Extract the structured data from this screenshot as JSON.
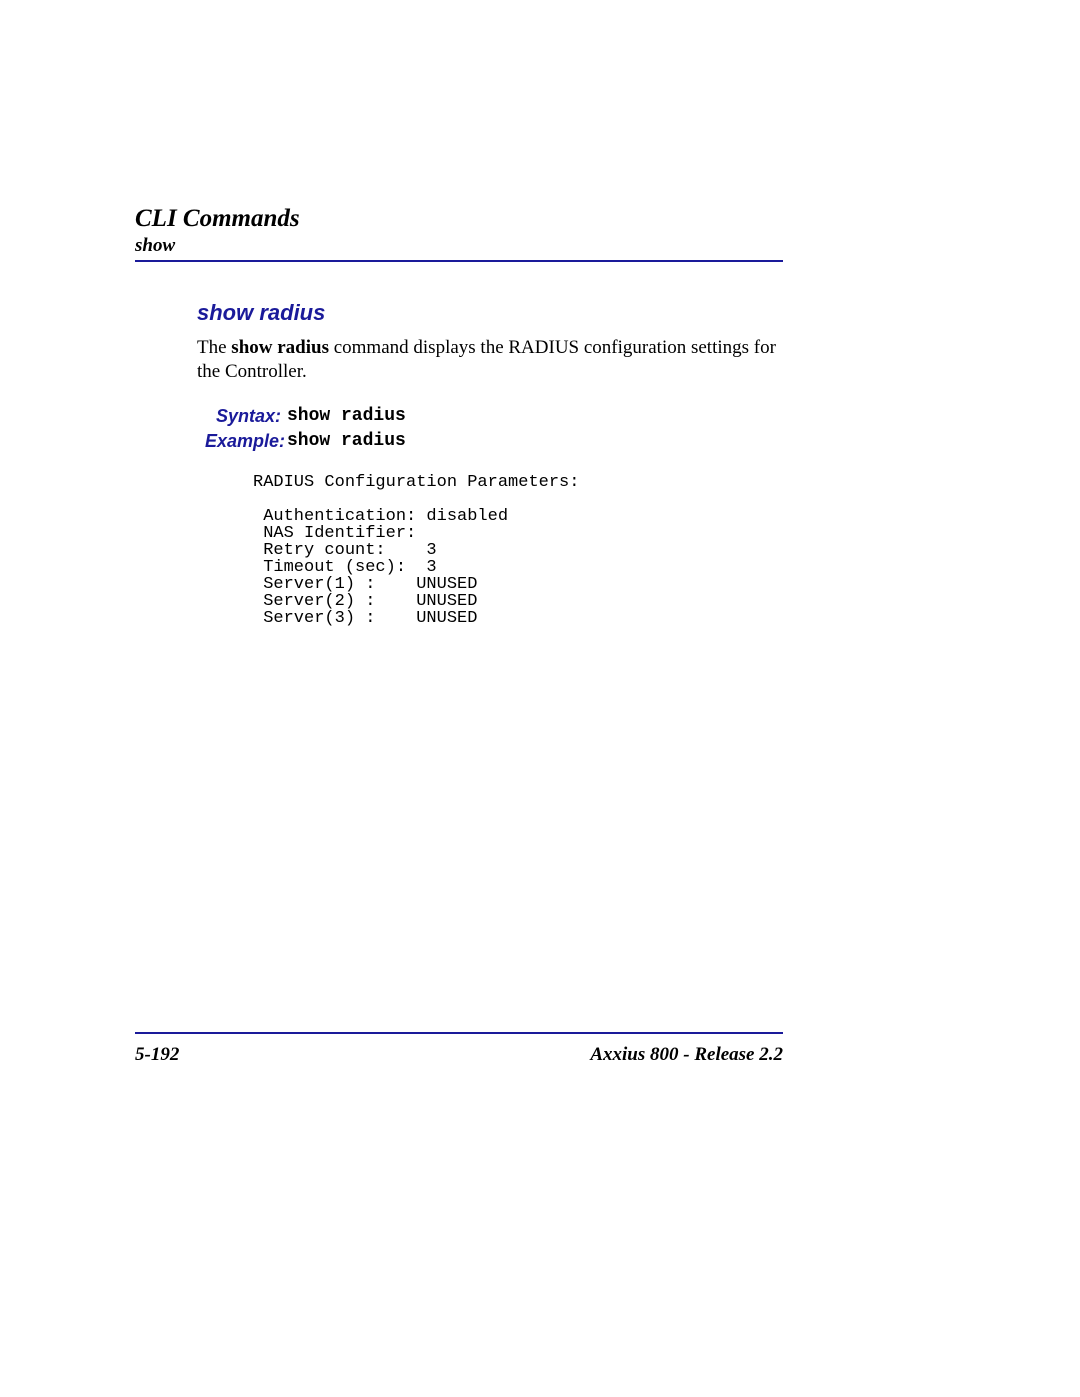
{
  "header": {
    "chapter": "CLI Commands",
    "subsection": "show"
  },
  "command": {
    "heading": "show radius",
    "description_pre": "The ",
    "description_bold": "show radius",
    "description_post": "  command displays the RADIUS configuration settings for the Controller.",
    "syntax_label": "Syntax:",
    "syntax_value": "show radius",
    "example_label": "Example:",
    "example_value": "show radius",
    "output": "RADIUS Configuration Parameters:\n\n Authentication: disabled\n NAS Identifier:\n Retry count:    3\n Timeout (sec):  3\n Server(1) :    UNUSED\n Server(2) :    UNUSED\n Server(3) :    UNUSED"
  },
  "footer": {
    "page_num": "5-192",
    "product": "Axxius 800 - Release 2.2"
  }
}
